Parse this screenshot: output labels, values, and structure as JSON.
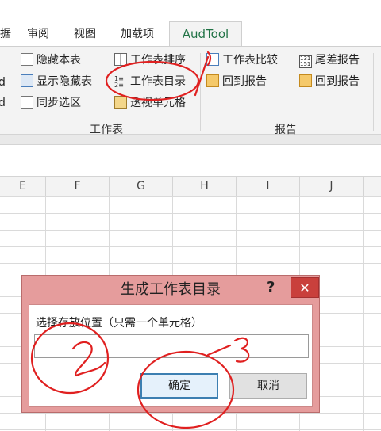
{
  "ribbon": {
    "tabs": [
      "据",
      "审阅",
      "视图",
      "加载项"
    ],
    "active_tab": "AudTool",
    "left_cut": [
      "d",
      "d"
    ],
    "sheet_group": {
      "label": "工作表",
      "buttons": [
        "隐藏本表",
        "显示隐藏表",
        "同步选区",
        "工作表排序",
        "工作表目录",
        "透视单元格"
      ]
    },
    "report_group": {
      "label": "报告",
      "buttons": [
        "工作表比较",
        "回到报告",
        "尾差报告",
        "回到报告"
      ]
    }
  },
  "grid": {
    "columns": [
      "E",
      "F",
      "G",
      "H",
      "I",
      "J"
    ]
  },
  "dialog": {
    "title": "生成工作表目录",
    "help": "?",
    "close": "✕",
    "label": "选择存放位置（只需一个单元格）",
    "input_value": "",
    "ok_label": "确定",
    "cancel_label": "取消"
  },
  "colors": {
    "accent_green": "#217346",
    "dialog_frame": "#e59c9c",
    "annotation_red": "#e02020"
  }
}
